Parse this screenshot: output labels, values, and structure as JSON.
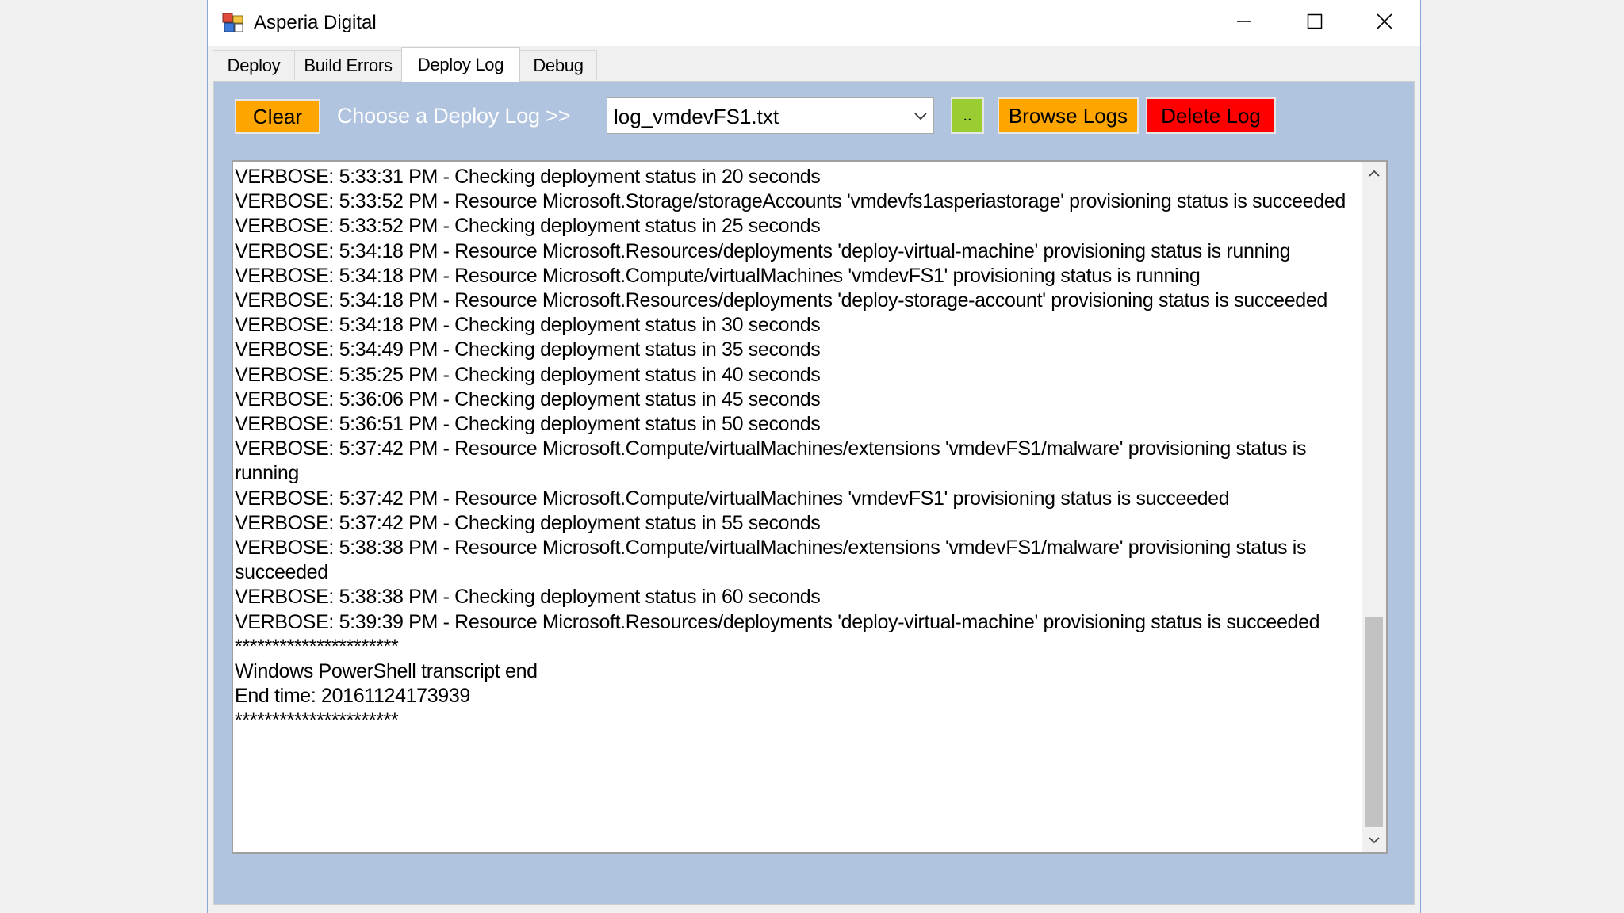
{
  "window": {
    "title": "Asperia Digital"
  },
  "tabs": [
    {
      "label": "Deploy",
      "active": false
    },
    {
      "label": "Build Errors",
      "active": false
    },
    {
      "label": "Deploy Log",
      "active": true
    },
    {
      "label": "Debug",
      "active": false
    }
  ],
  "toolbar": {
    "clear_label": "Clear",
    "choose_label": "Choose a Deploy Log >>",
    "selected_log": "log_vmdevFS1.txt",
    "dots_label": "..",
    "browse_label": "Browse Logs",
    "delete_label": "Delete Log"
  },
  "log": {
    "text": "VERBOSE: 5:33:31 PM - Checking deployment status in 20 seconds\nVERBOSE: 5:33:52 PM - Resource Microsoft.Storage/storageAccounts 'vmdevfs1asperiastorage' provisioning status is succeeded\nVERBOSE: 5:33:52 PM - Checking deployment status in 25 seconds\nVERBOSE: 5:34:18 PM - Resource Microsoft.Resources/deployments 'deploy-virtual-machine' provisioning status is running\nVERBOSE: 5:34:18 PM - Resource Microsoft.Compute/virtualMachines 'vmdevFS1' provisioning status is running\nVERBOSE: 5:34:18 PM - Resource Microsoft.Resources/deployments 'deploy-storage-account' provisioning status is succeeded\nVERBOSE: 5:34:18 PM - Checking deployment status in 30 seconds\nVERBOSE: 5:34:49 PM - Checking deployment status in 35 seconds\nVERBOSE: 5:35:25 PM - Checking deployment status in 40 seconds\nVERBOSE: 5:36:06 PM - Checking deployment status in 45 seconds\nVERBOSE: 5:36:51 PM - Checking deployment status in 50 seconds\nVERBOSE: 5:37:42 PM - Resource Microsoft.Compute/virtualMachines/extensions 'vmdevFS1/malware' provisioning status is running\nVERBOSE: 5:37:42 PM - Resource Microsoft.Compute/virtualMachines 'vmdevFS1' provisioning status is succeeded\nVERBOSE: 5:37:42 PM - Checking deployment status in 55 seconds\nVERBOSE: 5:38:38 PM - Resource Microsoft.Compute/virtualMachines/extensions 'vmdevFS1/malware' provisioning status is succeeded\nVERBOSE: 5:38:38 PM - Checking deployment status in 60 seconds\nVERBOSE: 5:39:39 PM - Resource Microsoft.Resources/deployments 'deploy-virtual-machine' provisioning status is succeeded\n**********************\nWindows PowerShell transcript end\nEnd time: 20161124173939\n**********************"
  },
  "colors": {
    "panel_bg": "#b0c3df",
    "clear_button": "#ffa500",
    "dots_button": "#9acd32",
    "browse_button": "#ffa500",
    "delete_button": "#ff0000"
  },
  "icons": {
    "app": "app-icon",
    "minimize": "minimize-icon",
    "maximize": "maximize-icon",
    "close": "close-icon",
    "dropdown": "chevron-down-icon",
    "scroll_up": "chevron-up-icon",
    "scroll_down": "chevron-down-icon"
  }
}
